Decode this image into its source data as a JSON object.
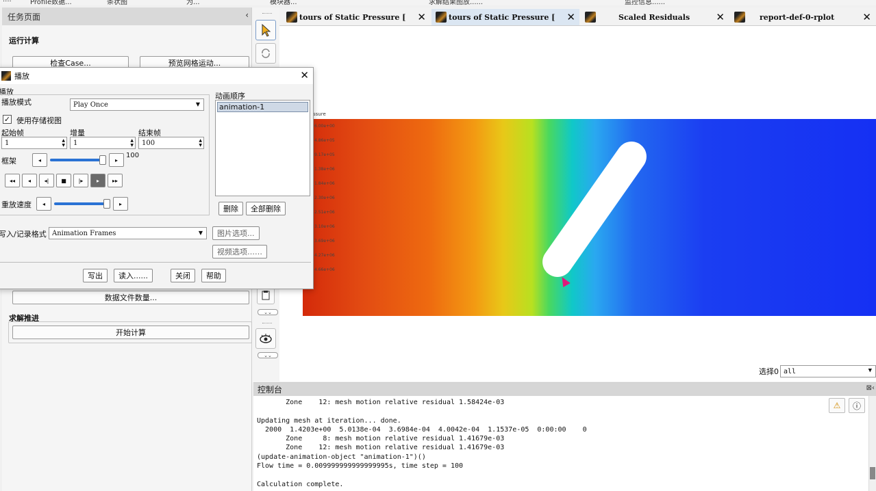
{
  "ribbon": {
    "items": [
      "....",
      "Profile数据...",
      "条状图",
      "为...",
      "模块器...",
      "求解结果图放......",
      "监控信息......"
    ]
  },
  "task_panel": {
    "title": "任务页面",
    "collapse_glyph": "‹",
    "run_section_title": "运行计算",
    "check_case_button": "检查Case...",
    "preview_mesh_button": "预览网格运动...",
    "data_file_button": "数据文件数量...",
    "solve_section_title": "求解推进",
    "start_calc_button": "开始计算"
  },
  "tabs": [
    {
      "label": "tours of Static Pressure [",
      "active": false
    },
    {
      "label": "tours of Static Pressure [",
      "active": true
    },
    {
      "label": "Scaled Residuals",
      "active": false
    },
    {
      "label": "report-def-0-rplot",
      "active": false
    }
  ],
  "tab_close_glyph": "✕",
  "viewport": {
    "colorbar_title": "ssure",
    "colorbar_labels": [
      "6.00e+00",
      "4.86e+05",
      "9.17e+05",
      "1.38e+06",
      "1.84e+06",
      "2.30e+06",
      "2.51e+06",
      "3.10e+06",
      "3.69e+06",
      "4.27e+06",
      "4.66e+06"
    ]
  },
  "selection": {
    "label": "选择0",
    "value": "all",
    "arrow": "▼"
  },
  "console": {
    "title": "控制台",
    "header_icons": "⊠‹",
    "warning_glyph": "⚠",
    "info_glyph": "ⓘ",
    "lines": [
      "       Zone    12: mesh motion relative residual 1.58424e-03",
      "",
      "Updating mesh at iteration... done.",
      "  2000  1.4203e+00  5.0138e-04  3.6984e-04  4.0042e-04  1.1537e-05  0:00:00    0",
      "       Zone     8: mesh motion relative residual 1.41679e-03",
      "       Zone    12: mesh motion relative residual 1.41679e-03",
      "(update-animation-object \"animation-1\")()",
      "Flow time = 0.009999999999999995s, time step = 100",
      "",
      "Calculation complete."
    ]
  },
  "dialog": {
    "title": "播放",
    "close_glyph": "✕",
    "section_label": "播放",
    "mode_label": "播放模式",
    "mode_value": "Play Once",
    "use_stored_view_label": "使用存储视图",
    "use_stored_view_checked": true,
    "check_glyph": "✓",
    "start_frame_label": "起始帧",
    "start_frame_value": "1",
    "increment_label": "增量",
    "increment_value": "1",
    "end_frame_label": "结束帧",
    "end_frame_value": "100",
    "frame_label": "框架",
    "frame_value": "100",
    "frame_fraction": 1.0,
    "speed_label": "重放速度",
    "speed_fraction": 1.0,
    "playback_buttons": [
      "◂◂",
      "◂",
      "◂|",
      "■",
      "|▸",
      "▸",
      "▸▸"
    ],
    "pressed_button_index": 5,
    "anim_sequence_label": "动画顺序",
    "anim_items": [
      "animation-1"
    ],
    "delete_button": "删除",
    "delete_all_button": "全部删除",
    "write_format_label": "写入/记录格式",
    "write_format_value": "Animation Frames",
    "image_options_button": "图片选项...",
    "video_options_button": "视频选项……",
    "write_button": "写出",
    "read_button": "读入......",
    "close_button": "关闭",
    "help_button": "帮助",
    "arrow_left": "◂",
    "arrow_right": "▸",
    "combo_arrow": "▼"
  }
}
